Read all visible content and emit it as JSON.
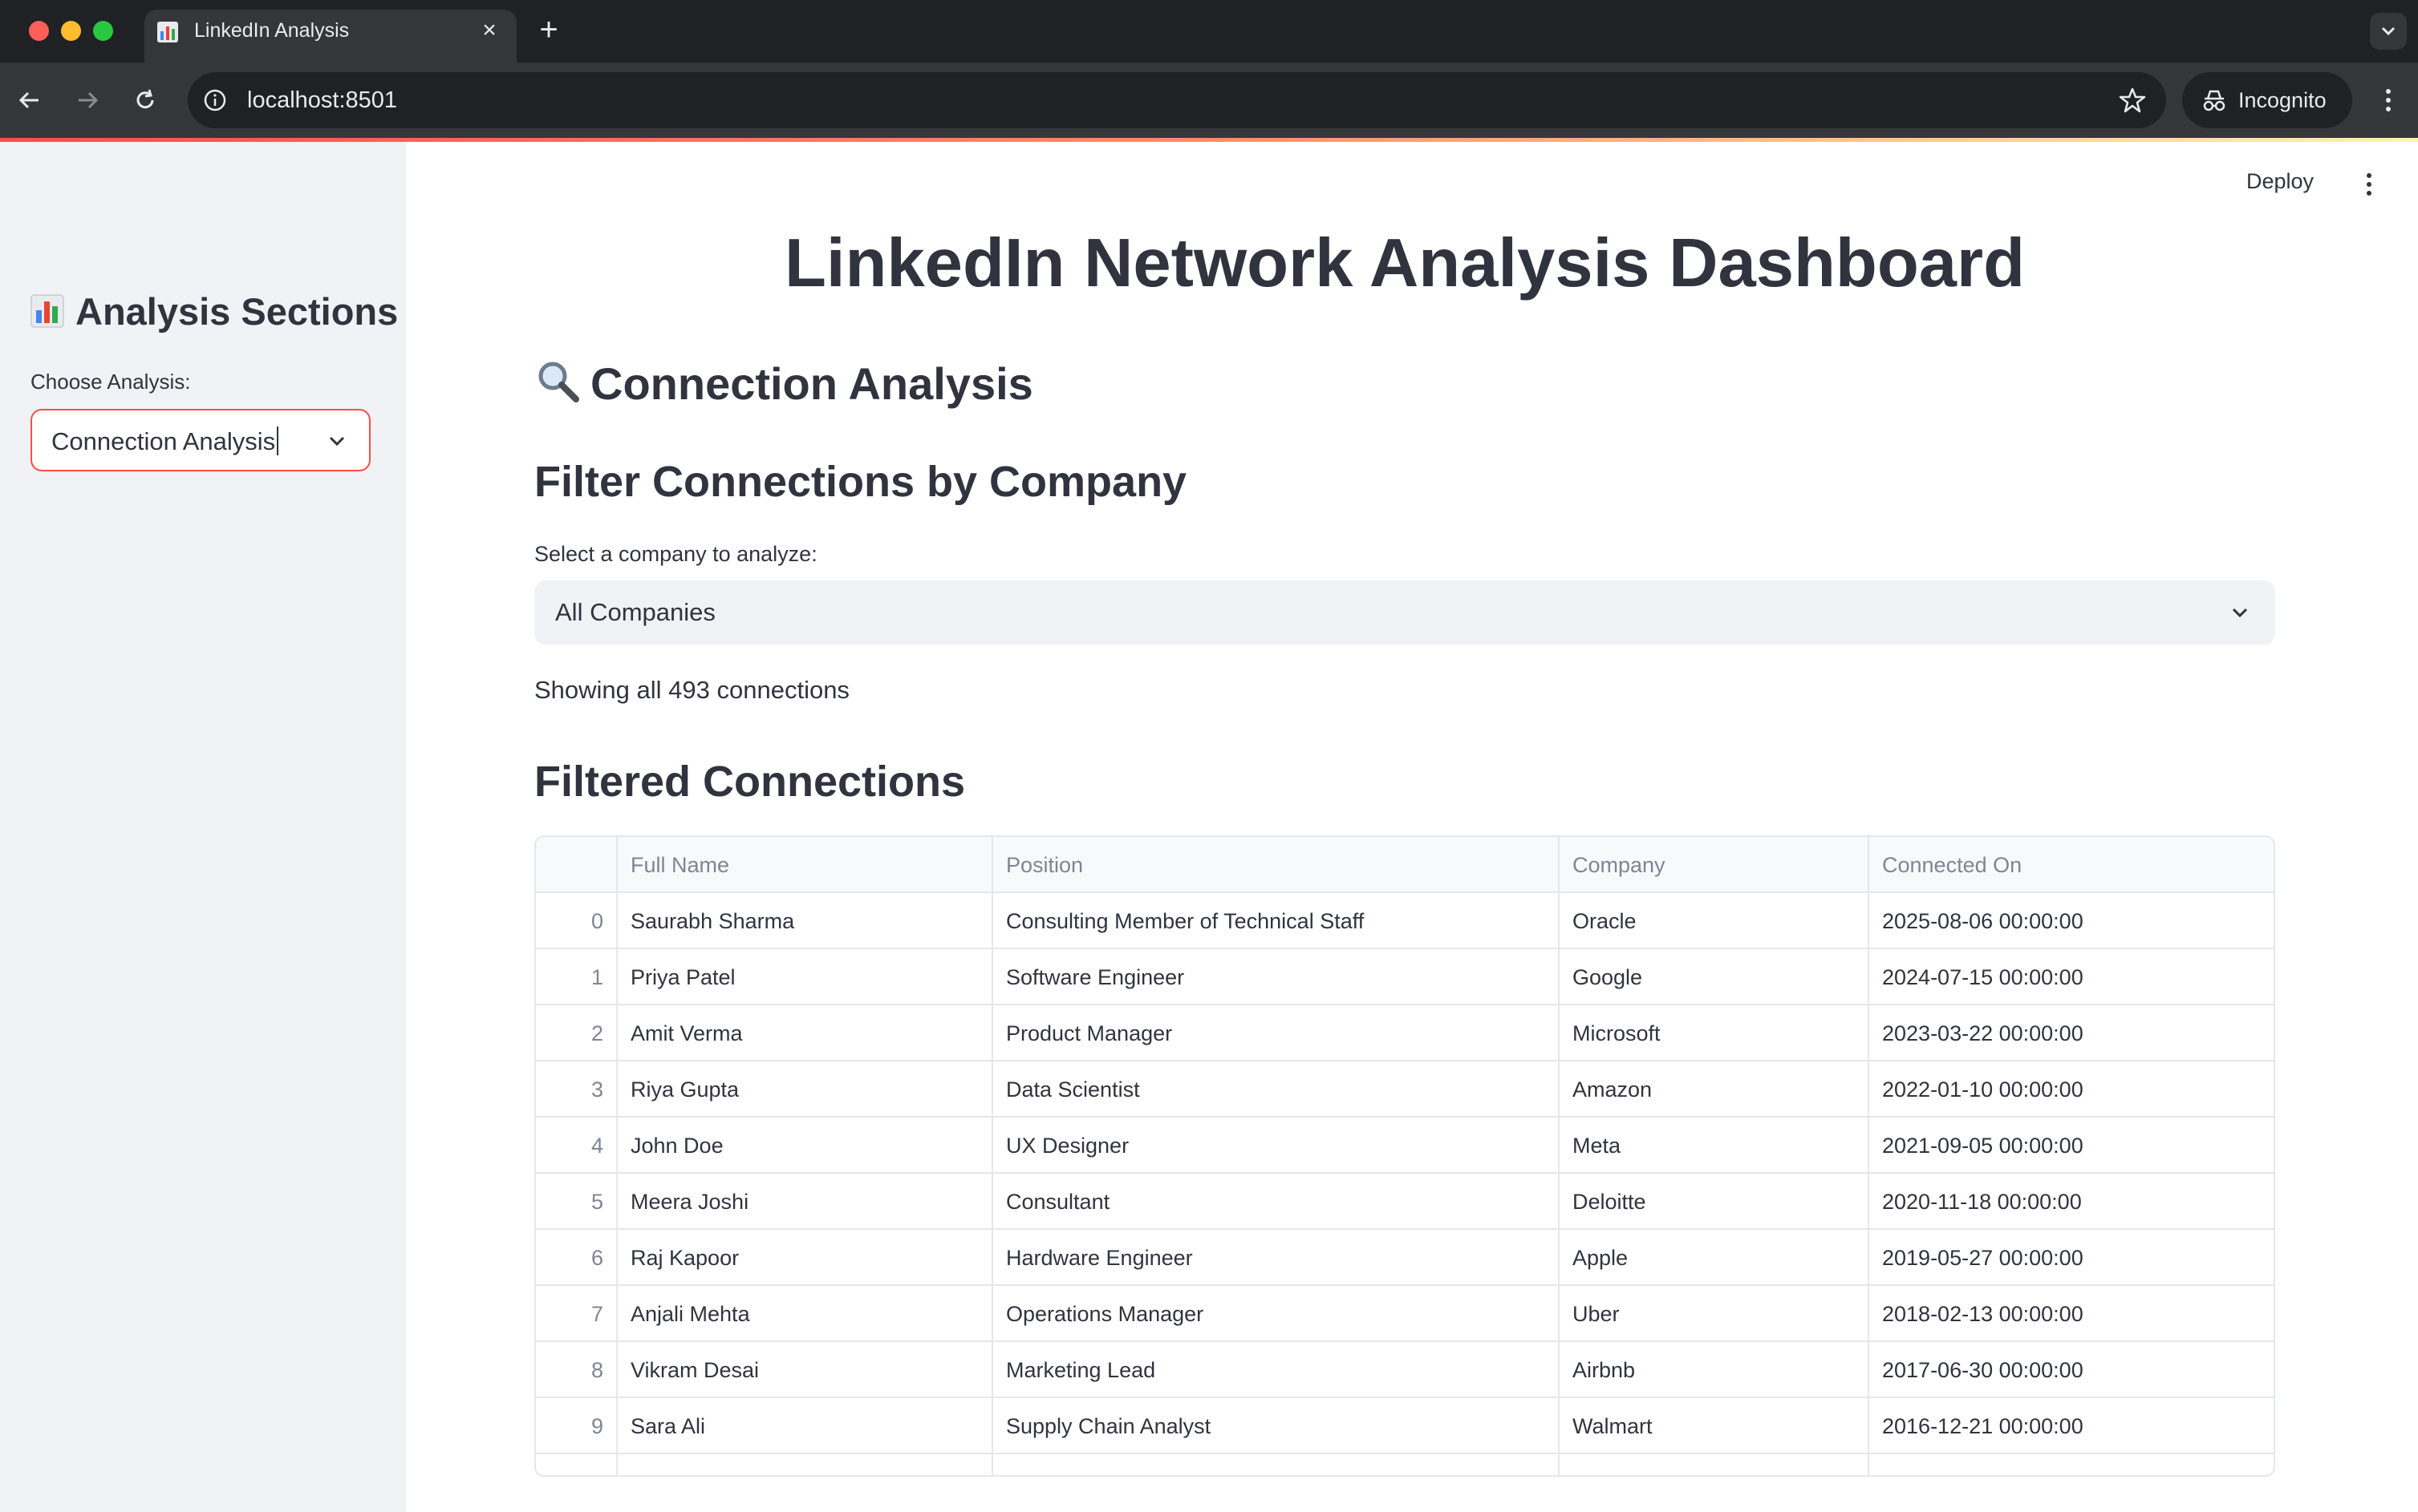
{
  "browser": {
    "tab_title": "LinkedIn Analysis",
    "url": "localhost:8501",
    "incognito_label": "Incognito"
  },
  "app": {
    "deploy_label": "Deploy",
    "title": "LinkedIn Network Analysis Dashboard"
  },
  "sidebar": {
    "heading": "Analysis Sections",
    "choose_label": "Choose Analysis:",
    "selected_analysis": "Connection Analysis"
  },
  "main": {
    "section_header": "Connection Analysis",
    "filter_header": "Filter Connections by Company",
    "company_label": "Select a company to analyze:",
    "company_selected": "All Companies",
    "showing_text": "Showing all 493 connections",
    "table_header": "Filtered Connections"
  },
  "table": {
    "columns": [
      "",
      "Full Name",
      "Position",
      "Company",
      "Connected On"
    ],
    "rows": [
      {
        "idx": "0",
        "name": "Saurabh Sharma",
        "position": "Consulting Member of Technical Staff",
        "company": "Oracle",
        "date": "2025-08-06 00:00:00"
      },
      {
        "idx": "1",
        "name": "Priya Patel",
        "position": "Software Engineer",
        "company": "Google",
        "date": "2024-07-15 00:00:00"
      },
      {
        "idx": "2",
        "name": "Amit Verma",
        "position": "Product Manager",
        "company": "Microsoft",
        "date": "2023-03-22 00:00:00"
      },
      {
        "idx": "3",
        "name": "Riya Gupta",
        "position": "Data Scientist",
        "company": "Amazon",
        "date": "2022-01-10 00:00:00"
      },
      {
        "idx": "4",
        "name": "John Doe",
        "position": "UX Designer",
        "company": "Meta",
        "date": "2021-09-05 00:00:00"
      },
      {
        "idx": "5",
        "name": "Meera Joshi",
        "position": "Consultant",
        "company": "Deloitte",
        "date": "2020-11-18 00:00:00"
      },
      {
        "idx": "6",
        "name": "Raj Kapoor",
        "position": "Hardware Engineer",
        "company": "Apple",
        "date": "2019-05-27 00:00:00"
      },
      {
        "idx": "7",
        "name": "Anjali Mehta",
        "position": "Operations Manager",
        "company": "Uber",
        "date": "2018-02-13 00:00:00"
      },
      {
        "idx": "8",
        "name": "Vikram Desai",
        "position": "Marketing Lead",
        "company": "Airbnb",
        "date": "2017-06-30 00:00:00"
      },
      {
        "idx": "9",
        "name": "Sara Ali",
        "position": "Supply Chain Analyst",
        "company": "Walmart",
        "date": "2016-12-21 00:00:00"
      }
    ]
  },
  "icons": {
    "tab_favicon": "bar-chart-icon",
    "sidebar_heading": "bar-chart-icon",
    "section_header": "magnifier-icon"
  },
  "colors": {
    "accent": "#ff4b4b",
    "sidebar_bg": "#f0f2f6",
    "text": "#31333f"
  }
}
